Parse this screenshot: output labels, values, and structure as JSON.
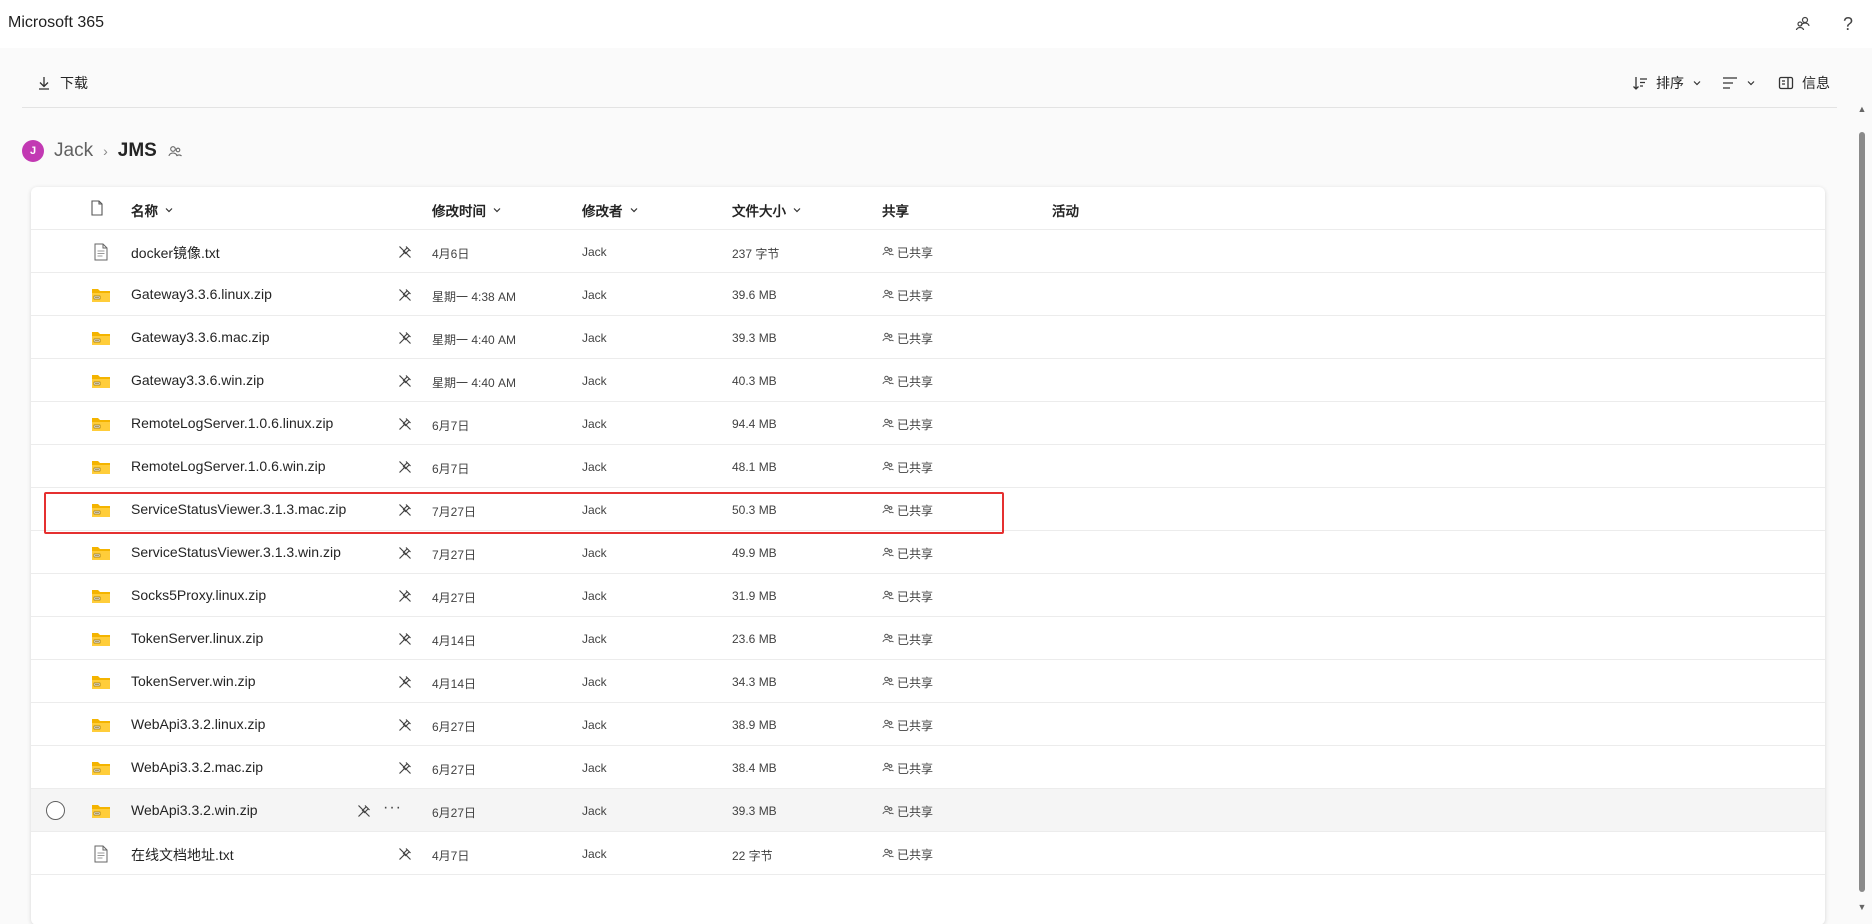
{
  "app": {
    "title": "Microsoft 365"
  },
  "toolbar": {
    "download_label": "下载",
    "sort_label": "排序",
    "info_label": "信息"
  },
  "breadcrumb": {
    "avatar_initial": "J",
    "root": "Jack",
    "current": "JMS"
  },
  "columns": {
    "name": "名称",
    "modified": "修改时间",
    "modifier": "修改者",
    "size": "文件大小",
    "sharing": "共享",
    "activity": "活动"
  },
  "files": [
    {
      "name": "docker镜像.txt",
      "type": "document",
      "modified": "4月6日",
      "modifier": "Jack",
      "size": "237 字节",
      "sharing": "已共享"
    },
    {
      "name": "Gateway3.3.6.linux.zip",
      "type": "zip",
      "modified": "星期一 4:38 AM",
      "modifier": "Jack",
      "size": "39.6 MB",
      "sharing": "已共享"
    },
    {
      "name": "Gateway3.3.6.mac.zip",
      "type": "zip",
      "modified": "星期一 4:40 AM",
      "modifier": "Jack",
      "size": "39.3 MB",
      "sharing": "已共享"
    },
    {
      "name": "Gateway3.3.6.win.zip",
      "type": "zip",
      "modified": "星期一 4:40 AM",
      "modifier": "Jack",
      "size": "40.3 MB",
      "sharing": "已共享"
    },
    {
      "name": "RemoteLogServer.1.0.6.linux.zip",
      "type": "zip",
      "modified": "6月7日",
      "modifier": "Jack",
      "size": "94.4 MB",
      "sharing": "已共享"
    },
    {
      "name": "RemoteLogServer.1.0.6.win.zip",
      "type": "zip",
      "modified": "6月7日",
      "modifier": "Jack",
      "size": "48.1 MB",
      "sharing": "已共享"
    },
    {
      "name": "ServiceStatusViewer.3.1.3.mac.zip",
      "type": "zip",
      "modified": "7月27日",
      "modifier": "Jack",
      "size": "50.3 MB",
      "sharing": "已共享"
    },
    {
      "name": "ServiceStatusViewer.3.1.3.win.zip",
      "type": "zip",
      "modified": "7月27日",
      "modifier": "Jack",
      "size": "49.9 MB",
      "sharing": "已共享"
    },
    {
      "name": "Socks5Proxy.linux.zip",
      "type": "zip",
      "modified": "4月27日",
      "modifier": "Jack",
      "size": "31.9 MB",
      "sharing": "已共享"
    },
    {
      "name": "TokenServer.linux.zip",
      "type": "zip",
      "modified": "4月14日",
      "modifier": "Jack",
      "size": "23.6 MB",
      "sharing": "已共享"
    },
    {
      "name": "TokenServer.win.zip",
      "type": "zip",
      "modified": "4月14日",
      "modifier": "Jack",
      "size": "34.3 MB",
      "sharing": "已共享"
    },
    {
      "name": "WebApi3.3.2.linux.zip",
      "type": "zip",
      "modified": "6月27日",
      "modifier": "Jack",
      "size": "38.9 MB",
      "sharing": "已共享"
    },
    {
      "name": "WebApi3.3.2.mac.zip",
      "type": "zip",
      "modified": "6月27日",
      "modifier": "Jack",
      "size": "38.4 MB",
      "sharing": "已共享"
    },
    {
      "name": "WebApi3.3.2.win.zip",
      "type": "zip",
      "modified": "6月27日",
      "modifier": "Jack",
      "size": "39.3 MB",
      "sharing": "已共享",
      "hovered": true
    },
    {
      "name": "在线文档地址.txt",
      "type": "document",
      "modified": "4月7日",
      "modifier": "Jack",
      "size": "22 字节",
      "sharing": "已共享"
    }
  ],
  "highlighted_row_index": 5,
  "icons": {
    "sharing_settings": "share-people-icon",
    "help": "help-icon",
    "download": "download-icon",
    "sort": "sort-icon",
    "view": "view-list-icon",
    "info": "info-panel-icon",
    "shared_folder": "people-icon",
    "pin": "pin-off-icon",
    "more": "more-icon"
  },
  "colors": {
    "avatar": "#c239b3",
    "zip_folder": "#f4b400",
    "highlight_box": "#e53030"
  }
}
